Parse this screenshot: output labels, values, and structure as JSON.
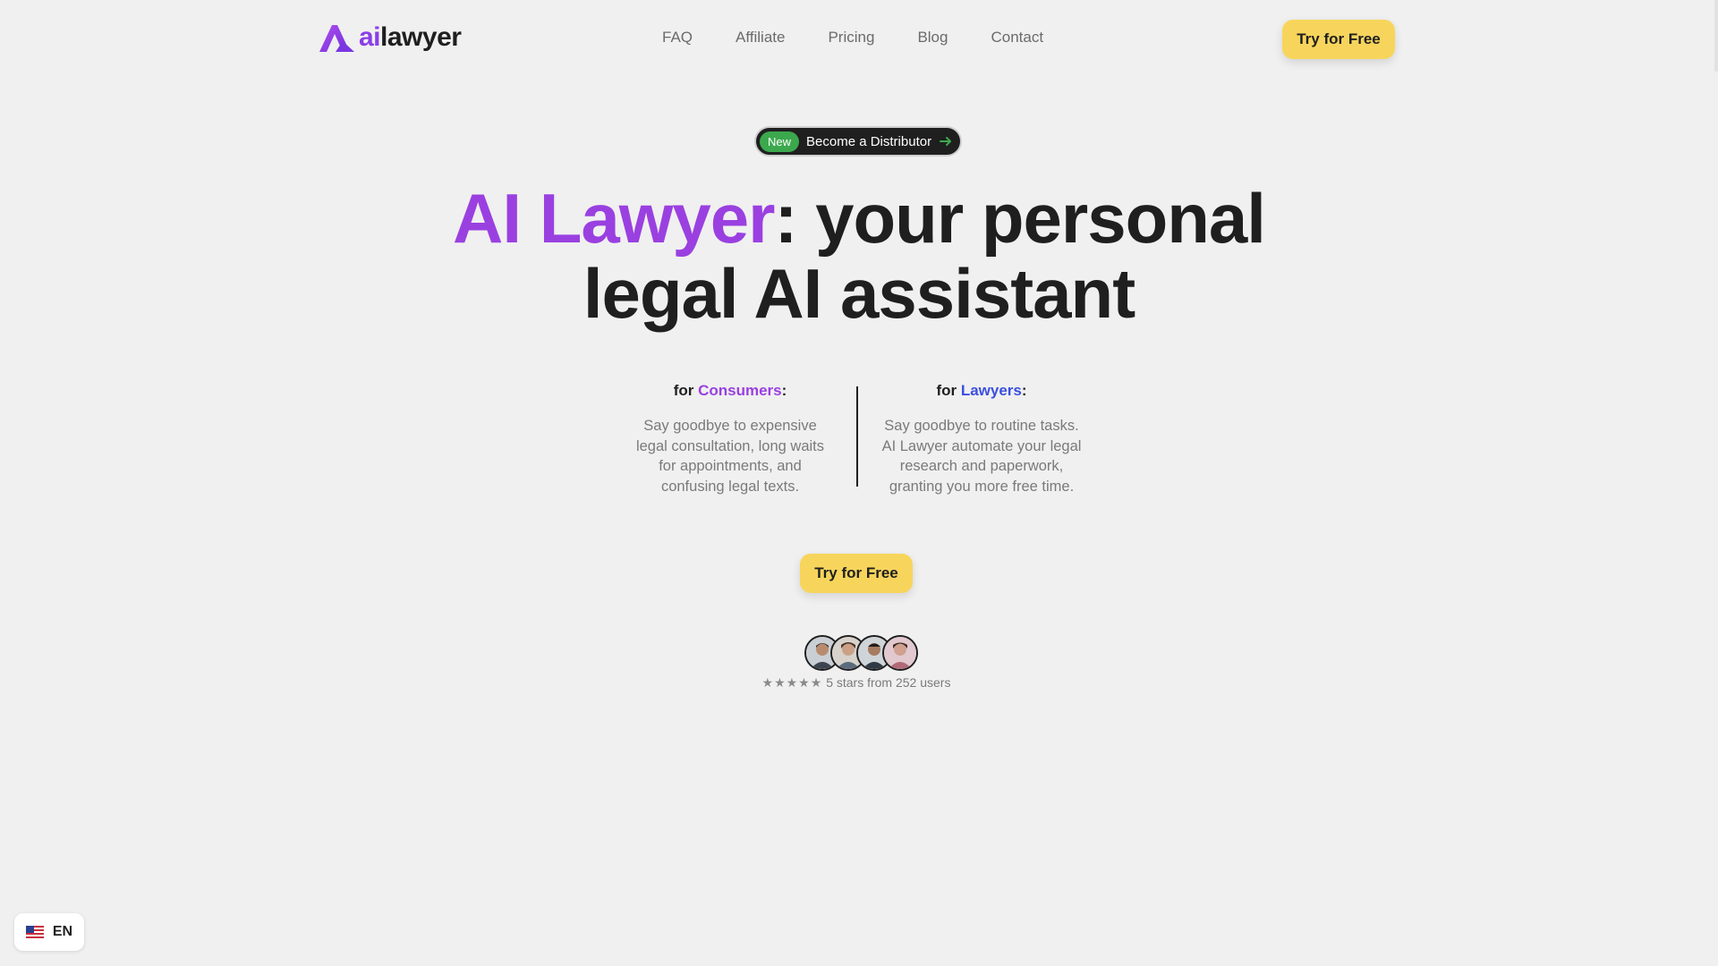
{
  "header": {
    "logo_ai": "ai",
    "logo_rest": "lawyer",
    "nav": [
      {
        "label": "FAQ"
      },
      {
        "label": "Affiliate"
      },
      {
        "label": "Pricing"
      },
      {
        "label": "Blog"
      },
      {
        "label": "Contact"
      }
    ],
    "cta_label": "Try for Free"
  },
  "pill": {
    "badge": "New",
    "label": "Become a Distributor",
    "arrow_icon": "arrow-right-icon"
  },
  "hero": {
    "title_accent": "AI Lawyer",
    "title_rest_line1": ": your personal",
    "title_line2": "legal AI assistant"
  },
  "audience": {
    "consumers": {
      "prefix": "for ",
      "name": "Consumers",
      "suffix": ":",
      "body": "Say goodbye to expensive legal consultation, long waits for appointments, and confusing legal texts."
    },
    "lawyers": {
      "prefix": "for ",
      "name": "Lawyers",
      "suffix": ":",
      "body": "Say goodbye to routine tasks. AI Lawyer automate your legal research and paperwork, granting you more free time."
    }
  },
  "hero_cta_label": "Try for Free",
  "social_proof": {
    "stars": "★★★★★",
    "text": "5 stars from 252 users"
  },
  "language": {
    "code": "EN",
    "flag_icon": "us-flag-icon"
  },
  "colors": {
    "background": "#f0f0f0",
    "accent_purple": "#9a40e0",
    "accent_blue": "#3b4fe0",
    "cta_yellow": "#f7d55c",
    "badge_green": "#3ca84d"
  }
}
